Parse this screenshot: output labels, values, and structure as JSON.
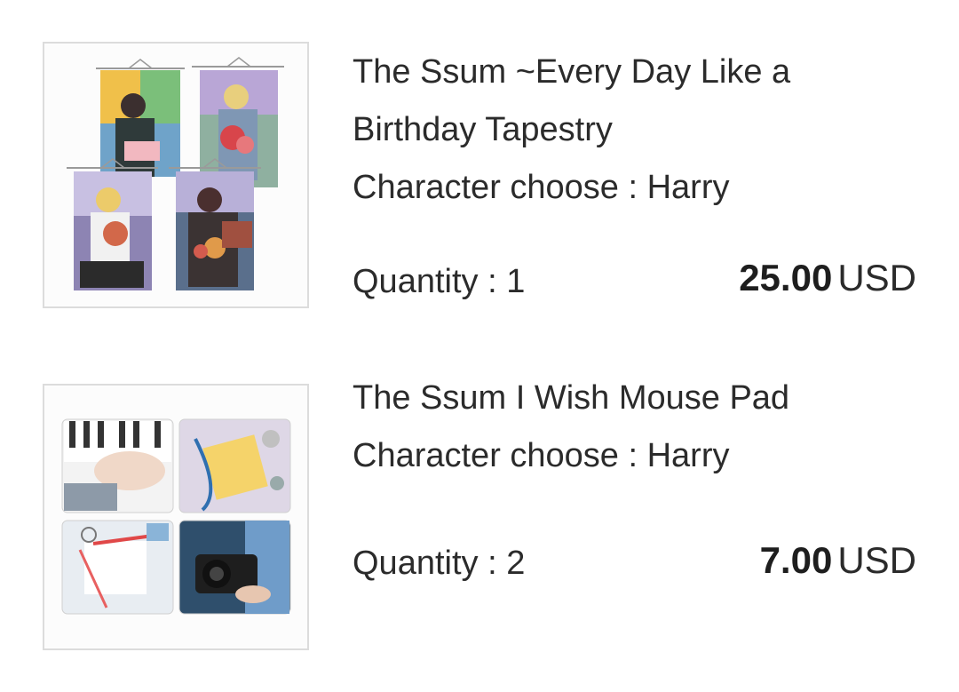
{
  "items": [
    {
      "name": "The Ssum ~Every Day Like a Birthday Tapestry",
      "option": "Character choose : Harry",
      "quantity": "Quantity : 1",
      "price_amount": "25.00",
      "price_currency": "USD",
      "image_icon": "tapestry-product-image"
    },
    {
      "name": "The Ssum I Wish Mouse Pad",
      "option": "Character choose : Harry",
      "quantity": "Quantity : 2",
      "price_amount": "7.00",
      "price_currency": "USD",
      "image_icon": "mouse-pad-product-image"
    }
  ],
  "colors": {
    "text": "#2b2b2b",
    "thumb_border": "#dcdcdc",
    "background": "#ffffff"
  }
}
